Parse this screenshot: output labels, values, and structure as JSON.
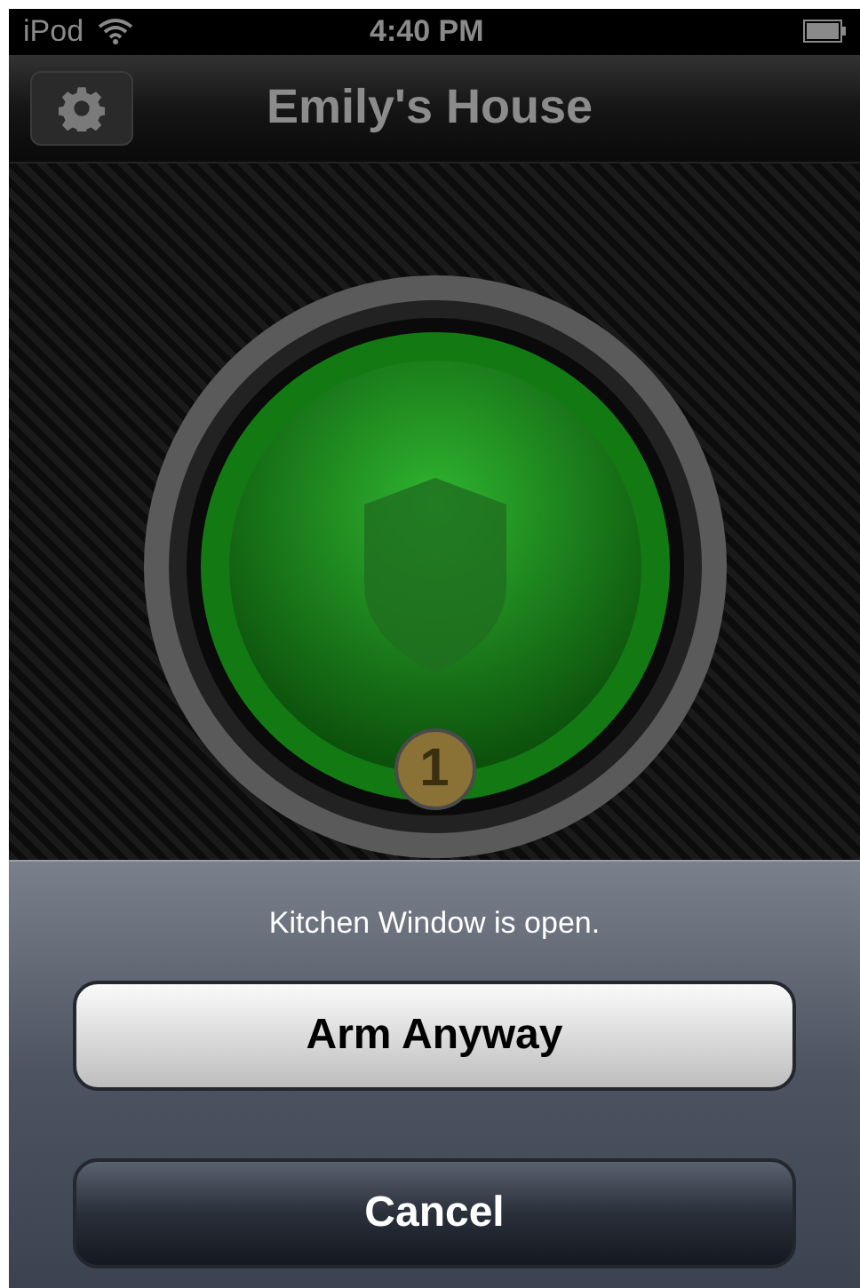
{
  "status_bar": {
    "carrier": "iPod",
    "time": "4:40 PM"
  },
  "nav_bar": {
    "title": "Emily's House"
  },
  "security_dial": {
    "badge": "1"
  },
  "action_sheet": {
    "message": "Kitchen Window is open.",
    "buttons": [
      {
        "label": "Arm Anyway",
        "kind": "default"
      },
      {
        "label": "Cancel",
        "kind": "cancel"
      }
    ]
  }
}
